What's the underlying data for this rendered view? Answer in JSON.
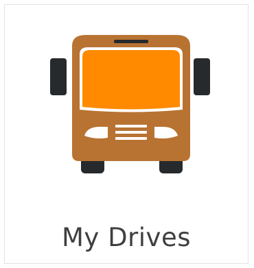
{
  "tile": {
    "label": "My Drives",
    "icon": "bus-icon"
  },
  "colors": {
    "bus_body": "#b87333",
    "bus_windshield": "#ff8a00",
    "bus_dark": "#262a2c",
    "bus_light": "#ffffff",
    "label_text": "#3f3f3f",
    "tile_border": "#e2e2e2"
  }
}
